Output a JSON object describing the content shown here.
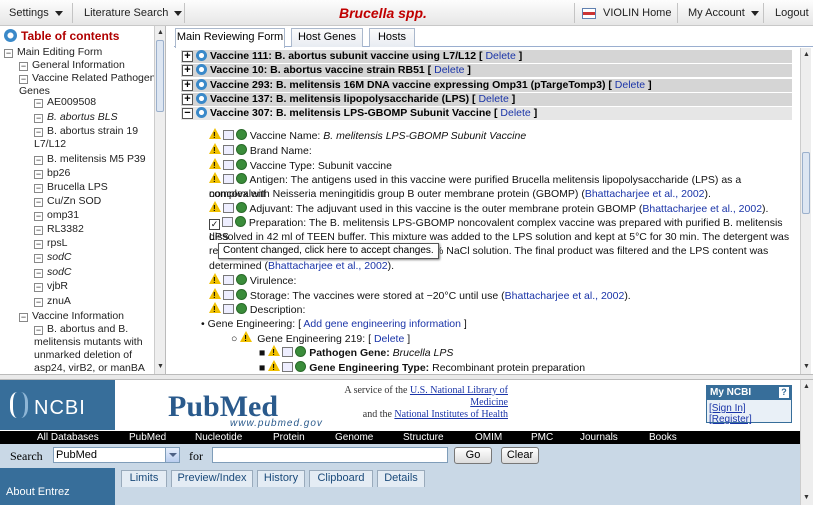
{
  "topbar": {
    "settings": "Settings",
    "literature": "Literature Search",
    "title": "Brucella spp.",
    "violin_home": "VIOLIN Home",
    "my_account": "My Account",
    "logout": "Logout"
  },
  "toc": {
    "header": "Table of contents",
    "items": [
      {
        "label": "Main Editing Form",
        "box": "−"
      },
      {
        "label": "General Information",
        "box": "−"
      },
      {
        "label": "Vaccine Related Pathogen Genes",
        "box": "−"
      },
      {
        "label": "AE009508",
        "box": "−"
      },
      {
        "label": "B. abortus BLS",
        "box": "−"
      },
      {
        "label": "B. abortus strain 19 L7/L12",
        "box": "−"
      },
      {
        "label": "B. melitensis M5 P39",
        "box": "−"
      },
      {
        "label": "bp26",
        "box": "−"
      },
      {
        "label": "Brucella LPS",
        "box": "−"
      },
      {
        "label": "Cu/Zn SOD",
        "box": "−"
      },
      {
        "label": "omp31",
        "box": "−"
      },
      {
        "label": "RL3382",
        "box": "−"
      },
      {
        "label": "rpsL",
        "box": "−"
      },
      {
        "label": "sodC",
        "box": "−"
      },
      {
        "label": "sodC",
        "box": "−"
      },
      {
        "label": "vjbR",
        "box": "−"
      },
      {
        "label": "znuA",
        "box": "−"
      },
      {
        "label": "Vaccine Information",
        "box": "−"
      },
      {
        "label": "B. abortus and B. melitensis mutants with unmarked deletion of asp24, virB2, or manBA",
        "box": "−"
      }
    ]
  },
  "tabs": [
    "Main Reviewing Form",
    "Host Genes",
    "Hosts"
  ],
  "vaccines": [
    {
      "box": "+",
      "label": "Vaccine 111: B. abortus subunit vaccine using L7/L12",
      "delete": "Delete"
    },
    {
      "box": "+",
      "label": "Vaccine 10: B. abortus vaccine strain RB51",
      "delete": "Delete"
    },
    {
      "box": "+",
      "label": "Vaccine 293: B. melitensis 16M DNA vaccine expressing Omp31 (pTargeTomp3)",
      "delete": "Delete"
    },
    {
      "box": "+",
      "label": "Vaccine 137: B. melitensis lipopolysaccharide (LPS)",
      "delete": "Delete"
    },
    {
      "box": "−",
      "label": "Vaccine 307: B. melitensis LPS-GBOMP Subunit Vaccine",
      "delete": "Delete"
    }
  ],
  "fields": {
    "name_label": "Vaccine Name:",
    "name_value": "B. melitensis LPS-GBOMP Subunit Vaccine",
    "brand_label": "Brand Name:",
    "type_label": "Vaccine Type:",
    "type_value": "Subunit vaccine",
    "antigen_label": "Antigen:",
    "antigen_text_1": "The antigens used in this vaccine were purified Brucella melitensis lipopolysaccharide (LPS) as a noncovalent",
    "antigen_text_2": "complex with Neisseria meningitidis group B outer membrane protein (GBOMP)",
    "antigen_cite": "Bhattacharjee et al., 2002",
    "adjuvant_label": "Adjuvant:",
    "adjuvant_text": "The adjuvant used in this vaccine is the outer membrane protein GBOMP",
    "adjuvant_cite": "Bhattacharjee et al., 2002",
    "prep_label": "Preparation:",
    "prep_text_1": "The B. melitensis LPS-GBOMP noncovalent complex vaccine was prepared with purified B. melitensis LPS",
    "prep_text_2": "dissolved in 42 ml of TEEN buffer. This mixture was added to the LPS solution and kept at 5°C for 30 min. The detergent was",
    "prep_text_3a": "re",
    "prep_text_3b": "% NaCl solution. The final product was filtered and the LPS content was",
    "prep_text_4": "determined",
    "prep_cite": "Bhattacharjee et al., 2002",
    "virulence_label": "Virulence:",
    "storage_label": "Storage:",
    "storage_text": "The vaccines were stored at −20°C until use",
    "storage_cite": "Bhattacharjee et al., 2002",
    "description_label": "Description:",
    "gene_eng_label": "Gene Engineering:",
    "gene_eng_add": "Add gene engineering information",
    "ge219_label": "Gene Engineering 219:",
    "ge219_delete": "Delete",
    "pathogen_gene_label": "Pathogen Gene:",
    "pathogen_gene_value": "Brucella LPS",
    "ge_type_label": "Gene Engineering Type:",
    "ge_type_value": "Recombinant protein preparation"
  },
  "tooltip": "Content changed, click here to accept changes.",
  "ncbi": {
    "logo": "NCBI",
    "pubmed": "PubMed",
    "pubmed_url": "www.pubmed.gov",
    "service_prefix": "A service of the",
    "service_nlm": "U.S. National Library of Medicine",
    "service_and": "and the",
    "service_nih": "National Institutes of Health",
    "myncbi_title": "My NCBI",
    "myncbi_help": "?",
    "sign_in": "[Sign In]",
    "register": "[Register]",
    "databases": [
      "All Databases",
      "PubMed",
      "Nucleotide",
      "Protein",
      "Genome",
      "Structure",
      "OMIM",
      "PMC",
      "Journals",
      "Books"
    ],
    "search_label": "Search",
    "search_db": "PubMed",
    "for_label": "for",
    "go": "Go",
    "clear": "Clear",
    "about": "About Entrez",
    "lower_tabs": [
      "Limits",
      "Preview/Index",
      "History",
      "Clipboard",
      "Details"
    ]
  }
}
